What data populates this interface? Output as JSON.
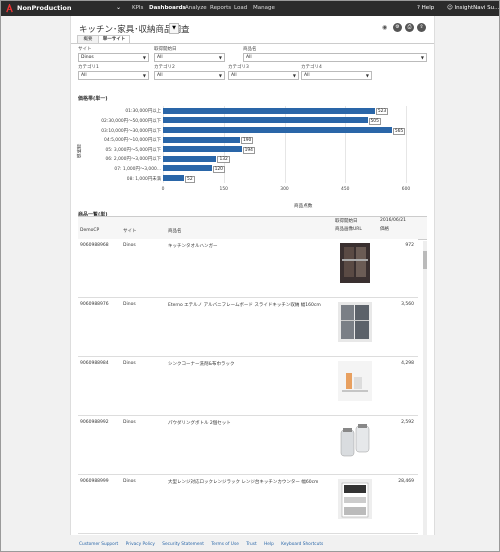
{
  "topbar": {
    "org_name": "NonProduction",
    "nav": [
      "KPIs",
      "Dashboards",
      "Analyze",
      "Reports",
      "Load",
      "Manage"
    ],
    "active_nav": "Dashboards",
    "help_label": "Help",
    "user_label": "InsightNavi Su..."
  },
  "page": {
    "title": "キッチン･家具･収納商品調査",
    "tabs": [
      "概要",
      "単一サイト"
    ],
    "active_tab": "単一サイト"
  },
  "filters": [
    {
      "label": "サイト",
      "value": "Dinos"
    },
    {
      "label": "取得開始日",
      "value": "All"
    },
    {
      "label": "商品名",
      "value": "All"
    },
    {
      "label": "カテゴリ1",
      "value": "All"
    },
    {
      "label": "カテゴリ2",
      "value": "All"
    },
    {
      "label": "カテゴリ3",
      "value": "All"
    },
    {
      "label": "カテゴリ4",
      "value": "All"
    }
  ],
  "chart_data": {
    "type": "bar",
    "title": "価格帯(単一)",
    "xlabel": "商品点数",
    "ylabel": "価格帯",
    "categories": [
      "01:30,000円以上",
      "02:30,000円〜50,000円以下",
      "03:10,000円〜30,000円以下",
      "04:5,000円〜10,000円以下",
      "05: 3,000円〜5,000円以下",
      "06: 2,000円〜3,000円以下",
      "07: 1,000円〜3,000...",
      "08: 1,000円未満"
    ],
    "values": [
      523,
      505,
      565,
      190,
      194,
      132,
      120,
      52
    ],
    "xlim": [
      0,
      600
    ],
    "xticks": [
      "0",
      "150",
      "300",
      "450",
      "600"
    ],
    "grid": true
  },
  "table": {
    "title": "商品一覧(単)",
    "headers": {
      "code": "DemoCP",
      "site": "サイト",
      "name": "商品名",
      "date_label": "取得開始日",
      "date_value": "2016/06/21",
      "image": "商品画像URL",
      "price": "価格"
    },
    "rows": [
      {
        "code": "9060988968",
        "site": "Dinos",
        "name": "キッチンタオルハンガー",
        "price": "972"
      },
      {
        "code": "9060988976",
        "site": "Dinos",
        "name": "Eterno エテルノ アルバニフレームボード スライドキッチン収納 幅160cm",
        "price": "3,560"
      },
      {
        "code": "9060988984",
        "site": "Dinos",
        "name": "シンクコーナー洗剤&布巾ラック",
        "price": "4,298"
      },
      {
        "code": "9060988992",
        "site": "Dinos",
        "name": "パウダリングボトル 2個セット",
        "price": "2,592"
      },
      {
        "code": "9060988999",
        "site": "Dinos",
        "name": "大型レンジ対応ロックレンジラック レンジ台キッチンカウンター 幅60cm",
        "price": "28,469"
      }
    ]
  },
  "footer": [
    "Customer Support",
    "Privacy Policy",
    "Security Statement",
    "Terms of Use",
    "Trust",
    "Help",
    "Keyboard Shortcuts"
  ],
  "colors": {
    "bar": "#2a66a8",
    "topbar": "#2b2b2b"
  }
}
